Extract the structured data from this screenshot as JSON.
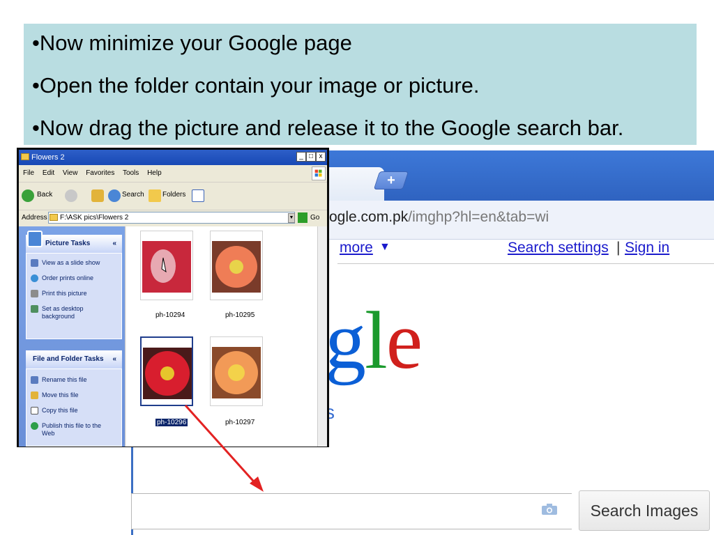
{
  "instructions": [
    "•Now minimize your Google page",
    "•Open the folder contain your image or picture.",
    "•Now drag the picture and release it to the Google search bar."
  ],
  "browser": {
    "url_domain": "ogle.com.pk",
    "url_path": "/imghp?hl=en&tab=wi",
    "more_label": "more",
    "more_arrow": "▼",
    "search_settings_label": "Search settings",
    "separator": "|",
    "sign_in_label": "Sign in",
    "logo_letters": [
      "g",
      "l",
      "e"
    ],
    "logo_sub": "s",
    "search_button_label": "Search Images",
    "tab_close": "×",
    "new_tab": "+"
  },
  "explorer": {
    "title": "Flowers 2",
    "title_buttons": [
      "_",
      "□",
      "x"
    ],
    "menu": [
      "File",
      "Edit",
      "View",
      "Favorites",
      "Tools",
      "Help"
    ],
    "toolbar": {
      "back_label": "Back",
      "search_label": "Search",
      "folders_label": "Folders"
    },
    "address_label": "Address",
    "address_value": "F:\\ASK pics\\Flowers 2",
    "go_label": "Go",
    "picture_tasks": {
      "title": "Picture Tasks",
      "chevron": "«",
      "items": [
        "View as a slide show",
        "Order prints online",
        "Print this picture",
        "Set as desktop",
        "background"
      ]
    },
    "file_tasks": {
      "title": "File and Folder Tasks",
      "chevron": "«",
      "items": [
        "Rename this file",
        "Move this file",
        "Copy this file",
        "Publish this file to the",
        "Web"
      ]
    },
    "files": [
      {
        "name": "ph-10294",
        "color": "#c8283c",
        "selected": false
      },
      {
        "name": "ph-10295",
        "color": "#ef7d56",
        "selected": false
      },
      {
        "name": "ph-10296",
        "color": "#d81e2e",
        "selected": true
      },
      {
        "name": "ph-10297",
        "color": "#f29a57",
        "selected": false
      }
    ]
  },
  "colors": {
    "instruction_bg": "#b9dde1",
    "chrome_blue": "#3d78d8",
    "link_blue": "#1a1acc",
    "arrow_red": "#e32222"
  }
}
